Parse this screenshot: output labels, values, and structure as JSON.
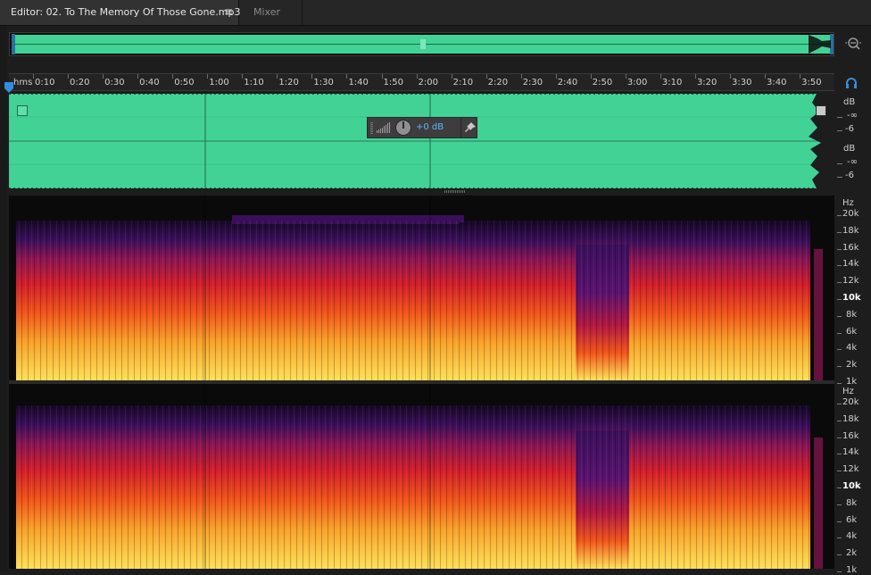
{
  "tabs": {
    "editor_label": "Editor: 02. To The Memory Of Those Gone.mp3",
    "menu_glyph": "≡",
    "mixer_label": "Mixer"
  },
  "ruler": {
    "unit": "hms",
    "ticks": [
      "0:10",
      "0:20",
      "0:30",
      "0:40",
      "0:50",
      "1:00",
      "1:10",
      "1:20",
      "1:30",
      "1:40",
      "1:50",
      "2:00",
      "2:10",
      "2:20",
      "2:30",
      "2:40",
      "2:50",
      "3:00",
      "3:10",
      "3:20",
      "3:30",
      "3:40",
      "3:50"
    ]
  },
  "hud": {
    "gain_value": "+0 dB"
  },
  "amplitude_scale": {
    "channel_1": {
      "unit": "dB",
      "inf": "-∞",
      "minus6": "-6"
    },
    "channel_2": {
      "unit": "dB",
      "inf": "-∞",
      "minus6": "-6"
    }
  },
  "frequency_scale": {
    "unit": "Hz",
    "labels": [
      "20k",
      "18k",
      "16k",
      "14k",
      "12k",
      "10k",
      "8k",
      "6k",
      "4k",
      "2k",
      "1k"
    ]
  },
  "colors": {
    "waveform": "#42d296",
    "accent_blue": "#2f8fdf",
    "hud_value": "#5cb7ff"
  },
  "icons": [
    "menu-icon",
    "zoom-navigator-icon",
    "playhead-marker-icon",
    "monitor-icon",
    "level-meter-icon",
    "gain-knob-icon",
    "pin-icon",
    "fade-handle-icon"
  ]
}
